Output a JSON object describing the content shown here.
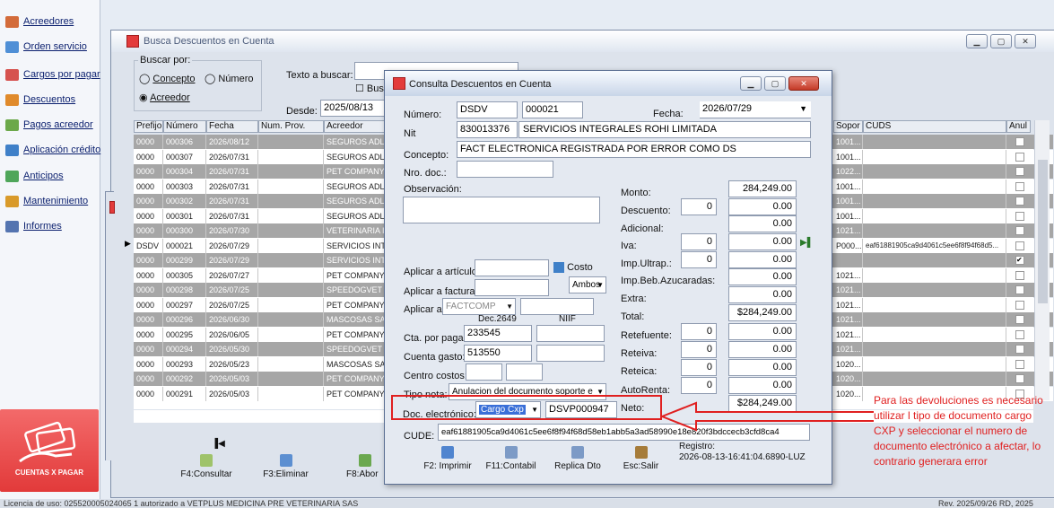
{
  "nav": {
    "items": [
      {
        "label": "Acreedores",
        "color": "#d36b3a"
      },
      {
        "label": "Orden servicio",
        "color": "#4f8fd6"
      },
      {
        "label": "Cargos por pagar",
        "color": "#d6524f"
      },
      {
        "label": "Descuentos",
        "color": "#e08a2b"
      },
      {
        "label": "Pagos acreedor",
        "color": "#6ca84a"
      },
      {
        "label": "Aplicación crédito",
        "color": "#3f80c8"
      },
      {
        "label": "Anticipos",
        "color": "#4fa65a"
      },
      {
        "label": "Mantenimiento",
        "color": "#d99a2a"
      },
      {
        "label": "Informes",
        "color": "#5474b0"
      }
    ],
    "logo_text": "CUENTAS X PAGAR"
  },
  "status": {
    "left": "Licencia de uso: 025520005024065 1 autorizado a VETPLUS MEDICINA PRE VETERINARIA SAS",
    "right": "Rev. 2025/09/26 RD, 2025"
  },
  "main": {
    "title": "Busca Descuentos en Cuenta",
    "search_by_label": "Buscar por:",
    "opt_concepto": "Concepto",
    "opt_numero": "Número",
    "opt_acreedor": "Acreedor",
    "text_search_label": "Texto a buscar:",
    "bus_label": "Bus",
    "desde_label": "Desde:",
    "desde_value": "2025/08/13",
    "columns": {
      "prefijo": "Prefijo",
      "numero": "Número",
      "fecha": "Fecha",
      "numprov": "Num. Prov.",
      "acreedor": "Acreedor",
      "sopor": "Sopor",
      "cuds": "CUDS",
      "anul": "Anul"
    },
    "rows": [
      {
        "p": "0000",
        "n": "000306",
        "f": "2026/08/12",
        "a": "SEGUROS ADL",
        "s": "1001...",
        "c": "",
        "x": false
      },
      {
        "p": "0000",
        "n": "000307",
        "f": "2026/07/31",
        "a": "SEGUROS ADL",
        "s": "1001...",
        "c": "",
        "x": false
      },
      {
        "p": "0000",
        "n": "000304",
        "f": "2026/07/31",
        "a": "PET COMPANY",
        "s": "1022...",
        "c": "",
        "x": false
      },
      {
        "p": "0000",
        "n": "000303",
        "f": "2026/07/31",
        "a": "SEGUROS ADL",
        "s": "1001...",
        "c": "",
        "x": false
      },
      {
        "p": "0000",
        "n": "000302",
        "f": "2026/07/31",
        "a": "SEGUROS ADL",
        "s": "1001...",
        "c": "",
        "x": false
      },
      {
        "p": "0000",
        "n": "000301",
        "f": "2026/07/31",
        "a": "SEGUROS ADL",
        "s": "1001...",
        "c": "",
        "x": false
      },
      {
        "p": "0000",
        "n": "000300",
        "f": "2026/07/30",
        "a": "VETERINARIA I",
        "s": "1021...",
        "c": "",
        "x": false
      },
      {
        "p": "DSDV",
        "n": "000021",
        "f": "2026/07/29",
        "a": "SERVICIOS INT",
        "s": "P000...",
        "c": "eaf61881905ca9d4061c5ee6f8f94f68d5...",
        "x": false,
        "sel": true
      },
      {
        "p": "0000",
        "n": "000299",
        "f": "2026/07/29",
        "a": "SERVICIOS INT",
        "s": "",
        "c": "",
        "x": true
      },
      {
        "p": "0000",
        "n": "000305",
        "f": "2026/07/27",
        "a": "PET COMPANY",
        "s": "1021...",
        "c": "",
        "x": false
      },
      {
        "p": "0000",
        "n": "000298",
        "f": "2026/07/25",
        "a": "SPEEDOGVET",
        "s": "1021...",
        "c": "",
        "x": false
      },
      {
        "p": "0000",
        "n": "000297",
        "f": "2026/07/25",
        "a": "PET COMPANY",
        "s": "1021...",
        "c": "",
        "x": false
      },
      {
        "p": "0000",
        "n": "000296",
        "f": "2026/06/30",
        "a": "MASCOSAS SA",
        "s": "1021...",
        "c": "",
        "x": false
      },
      {
        "p": "0000",
        "n": "000295",
        "f": "2026/06/05",
        "a": "PET COMPANY",
        "s": "1021...",
        "c": "",
        "x": false
      },
      {
        "p": "0000",
        "n": "000294",
        "f": "2026/05/30",
        "a": "SPEEDOGVET",
        "s": "1021...",
        "c": "",
        "x": false
      },
      {
        "p": "0000",
        "n": "000293",
        "f": "2026/05/23",
        "a": "MASCOSAS SA",
        "s": "1020...",
        "c": "",
        "x": false
      },
      {
        "p": "0000",
        "n": "000292",
        "f": "2026/05/03",
        "a": "PET COMPANY",
        "s": "1020...",
        "c": "",
        "x": false
      },
      {
        "p": "0000",
        "n": "000291",
        "f": "2026/05/03",
        "a": "PET COMPANY",
        "s": "1020...",
        "c": "",
        "x": false
      }
    ],
    "btn_consultar": "F4:Consultar",
    "btn_eliminar": "F3:Eliminar",
    "btn_abonar": "F8:Abor"
  },
  "dialog": {
    "title": "Consulta Descuentos en Cuenta",
    "numero_label": "Número:",
    "numero_prefix": "DSDV",
    "numero_value": "000021",
    "fecha_label": "Fecha:",
    "fecha_value": "2026/07/29",
    "nit_label": "Nit",
    "nit_value": "830013376",
    "nit_name": "SERVICIOS INTEGRALES ROHI LIMITADA",
    "concepto_label": "Concepto:",
    "concepto_value": "FACT ELECTRONICA REGISTRADA POR ERROR COMO DS",
    "nrodoc_label": "Nro. doc.:",
    "observacion_label": "Observación:",
    "monto_label": "Monto:",
    "monto_value": "284,249.00",
    "descuento_label": "Descuento:",
    "descuento_pct": "0",
    "descuento_value": "0.00",
    "adicional_label": "Adicional:",
    "adicional_value": "0.00",
    "iva_label": "Iva:",
    "iva_pct": "0",
    "iva_value": "0.00",
    "impultrap_label": "Imp.Ultrap.:",
    "impultrap_pct": "0",
    "impultrap_value": "0.00",
    "impbeb_label": "Imp.Beb.Azucaradas:",
    "impbeb_value": "0.00",
    "extra_label": "Extra:",
    "extra_value": "0.00",
    "total_label": "Total:",
    "total_value": "$284,249.00",
    "retefuente_label": "Retefuente:",
    "retefuente_pct": "0",
    "retefuente_value": "0.00",
    "reteiva_label": "Reteiva:",
    "reteiva_pct": "0",
    "reteiva_value": "0.00",
    "reteica_label": "Reteica:",
    "reteica_pct": "0",
    "reteica_value": "0.00",
    "autorenta_label": "AutoRenta:",
    "autorenta_pct": "0",
    "autorenta_value": "0.00",
    "neto_label": "Neto:",
    "neto_value": "$284,249.00",
    "aplicar_articulo_label": "Aplicar a artículo:",
    "costo_label": "Costo",
    "ambos_value": "Ambos",
    "aplicar_factura_label": "Aplicar a factura:",
    "aplicar_a_label": "Aplicar a:",
    "aplicar_a_value": "FACTCOMP",
    "dec_header": "Dec.2649",
    "niif_header": "NIIF",
    "cta_pagar_label": "Cta. por pagar:",
    "cta_pagar_value": "233545",
    "cuenta_gasto_label": "Cuenta gasto:",
    "cuenta_gasto_value": "513550",
    "centro_costos_label": "Centro costos:",
    "tipo_nota_label": "Tipo nota:",
    "tipo_nota_value": "Anulacion del documento soporte e",
    "doc_elec_label": "Doc. electrónico:",
    "doc_elec_value": "Cargo Cxp",
    "doc_elec_num": "DSVP000947",
    "cude_label": "CUDE:",
    "cude_value": "eaf61881905ca9d4061c5ee6f8f94f68d58eb1abb5a3ad58990e18e820f3bdccecb3cfd8ca4",
    "btn_imprimir": "F2: Imprimir",
    "btn_contabil": "F11:Contabil",
    "btn_replica": "Replica Dto",
    "btn_salir": "Esc:Salir",
    "registro_label": "Registro:",
    "registro_value": "2026-08-13-16:41:04.6890-LUZ"
  },
  "annotation": "Para las devoluciones es necesario utilizar l tipo de documento cargo CXP y seleccionar el numero de documento electrónico a afectar, lo contrario generara error"
}
